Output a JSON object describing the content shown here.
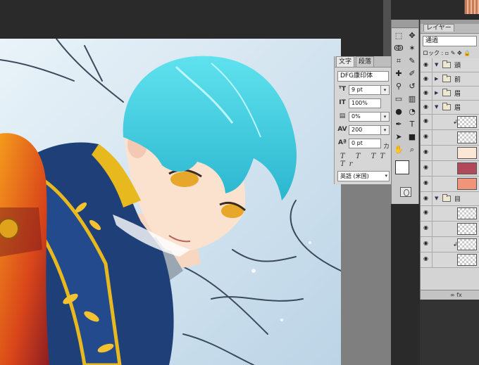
{
  "character_panel": {
    "tabs": [
      "文字",
      "段落"
    ],
    "font": "DFG康印体",
    "size": "9 pt",
    "leading": "100%",
    "tracking_percent": "0%",
    "tracking": "200",
    "baseline": "0 pt",
    "baseline_suffix": "カ",
    "style_buttons": "T T TT Tr",
    "language": "英語 (米国)"
  },
  "tools": {
    "icons": [
      "marquee-icon",
      "move-icon",
      "lasso-icon",
      "magic-wand-icon",
      "crop-icon",
      "eyedropper-icon",
      "heal-icon",
      "brush-icon",
      "stamp-icon",
      "history-brush-icon",
      "eraser-icon",
      "gradient-icon",
      "blur-icon",
      "dodge-icon",
      "pen-icon",
      "type-icon",
      "path-select-icon",
      "shape-icon",
      "hand-icon",
      "zoom-icon"
    ],
    "glyphs": [
      "⬚",
      "✥",
      "ↂ",
      "✶",
      "⌗",
      "✎",
      "✚",
      "✐",
      "⚲",
      "↺",
      "▭",
      "▥",
      "●",
      "◔",
      "✒",
      "T",
      "➤",
      "■",
      "✋",
      "⌕"
    ]
  },
  "layers_panel": {
    "tab": "レイヤー",
    "blend_mode": "通過",
    "lock_label": "ロック :",
    "groups": [
      {
        "name": "頭",
        "expanded": true
      },
      {
        "name": "前",
        "expanded": false
      },
      {
        "name": "眉",
        "expanded": false
      },
      {
        "name": "眉",
        "expanded": true
      },
      {
        "name": "目",
        "expanded": true
      }
    ],
    "footer": "∞  fx"
  },
  "colors": {
    "foreground": "#ffffff",
    "background": "#111111",
    "thumb_swatches": [
      "#fbe8d4",
      "#b04a5a",
      "#f0957a"
    ]
  }
}
